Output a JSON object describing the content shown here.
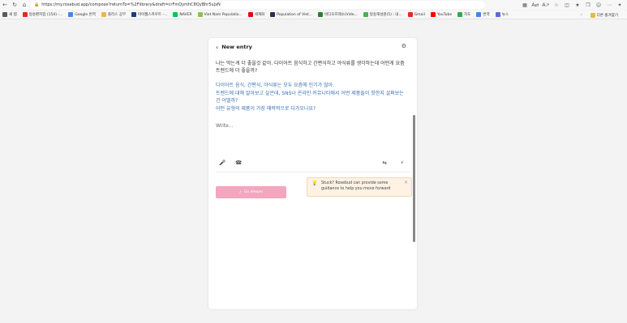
{
  "browser": {
    "url": "https://my.rosebud.app/compose?returnTo=%2Flibrary&draft=crFmQymhC8QyBhr5ujxN",
    "toolbar_icons": [
      "back-icon",
      "refresh-icon",
      "home-icon",
      "lock-icon",
      "reader-icon",
      "translate-icon",
      "read-aloud-icon",
      "favorite-icon",
      "split-icon",
      "favorites-list-icon",
      "collections-icon",
      "profile-icon",
      "more-icon",
      "copilot-icon"
    ]
  },
  "bookmarks": {
    "items": [
      {
        "label": "새 탭",
        "color": "#5a5a5a"
      },
      {
        "label": "방송편지함 (154) -...",
        "color": "#d93025"
      },
      {
        "label": "Google 번역",
        "color": "#4285f4"
      },
      {
        "label": "플러스 공부",
        "color": "#e8b84a"
      },
      {
        "label": "마이웹스카우트 -...",
        "color": "#1a3d7c"
      },
      {
        "label": "NAVER",
        "color": "#03c75a"
      },
      {
        "label": "Viet Nam Populatio...",
        "color": "#8bc34a"
      },
      {
        "label": "세계화",
        "color": "#e50914"
      },
      {
        "label": "Population of Viet...",
        "color": "#2c2c54"
      },
      {
        "label": "비디오프레소(Vide...",
        "color": "#2e7d32"
      },
      {
        "label": "방송해설원(5) : 내...",
        "color": "#4caf50"
      },
      {
        "label": "Gmail",
        "color": "#d93025"
      },
      {
        "label": "YouTube",
        "color": "#ff0000"
      },
      {
        "label": "지도",
        "color": "#34a853"
      },
      {
        "label": "번역",
        "color": "#4285f4"
      },
      {
        "label": "뉴스",
        "color": "#5e6ad2"
      }
    ],
    "other_label": "다른 즐겨찾기"
  },
  "entry": {
    "title": "New entry",
    "prompt": "나는 먹는게 더 좋을것 같아. 다이어트 음식하고 간편식하고 야식류를 생각하는데 어떤게 요즘 트렌드에 더 좋을까?",
    "guides": [
      "다이어트 음식, 간편식, 야식류는 모두 요즘에 인기가 많아.",
      "트렌드에 대해 알아보고 싶은데, SNS나 온라인 커뮤니티에서 어떤 제품들이 핫한지 살펴보는 건 어떨까?",
      "어떤 유형의 제품이 가장 매력적으로 다가오나요?"
    ],
    "write_placeholder": "Write...",
    "go_deeper_label": "Go deeper",
    "tip_text": "Stuck? Rosebud can provide some guidance to help you move forward"
  },
  "colors": {
    "accent_pink": "#f3a6bd",
    "guide_blue": "#3a6fb0",
    "tip_bg": "#fdf2e4"
  }
}
